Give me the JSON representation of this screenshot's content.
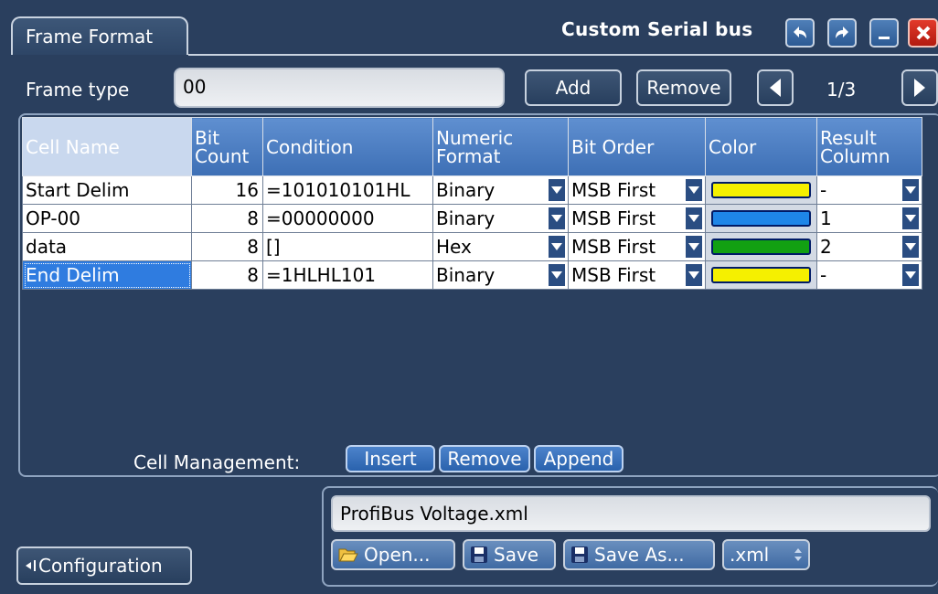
{
  "header": {
    "tab_label": "Frame Format",
    "title": "Custom Serial bus",
    "buttons": [
      "undo-icon",
      "redo-icon",
      "minimize-icon",
      "close-icon"
    ]
  },
  "frame_type": {
    "label": "Frame type",
    "value": "00",
    "add_label": "Add",
    "remove_label": "Remove",
    "page": "1/3"
  },
  "table": {
    "headers": {
      "cell_name": "Cell Name",
      "bit_count": "Bit Count",
      "condition": "Condition",
      "numeric_format": "Numeric Format",
      "bit_order": "Bit Order",
      "color": "Color",
      "result_column": "Result Column"
    },
    "rows": [
      {
        "name": "Start Delim",
        "bits": "16",
        "condition": "=101010101HL",
        "format": "Binary",
        "order": "MSB First",
        "color": "#f5f000",
        "result": "-"
      },
      {
        "name": "OP-00",
        "bits": "8",
        "condition": "=00000000",
        "format": "Binary",
        "order": "MSB First",
        "color": "#1e86e8",
        "result": "1"
      },
      {
        "name": "data",
        "bits": "8",
        "condition": "[]",
        "format": "Hex",
        "order": "MSB First",
        "color": "#12a012",
        "result": "2"
      },
      {
        "name": "End Delim",
        "bits": "8",
        "condition": "=1HLHL101",
        "format": "Binary",
        "order": "MSB First",
        "color": "#f5f000",
        "result": "-"
      }
    ]
  },
  "cell_management": {
    "label": "Cell Management:",
    "insert_label": "Insert",
    "remove_label": "Remove",
    "append_label": "Append"
  },
  "file": {
    "filename": "ProfiBus Voltage.xml",
    "open_label": "Open...",
    "save_label": "Save",
    "save_as_label": "Save As...",
    "extension": ".xml"
  },
  "configuration_label": "Configuration"
}
